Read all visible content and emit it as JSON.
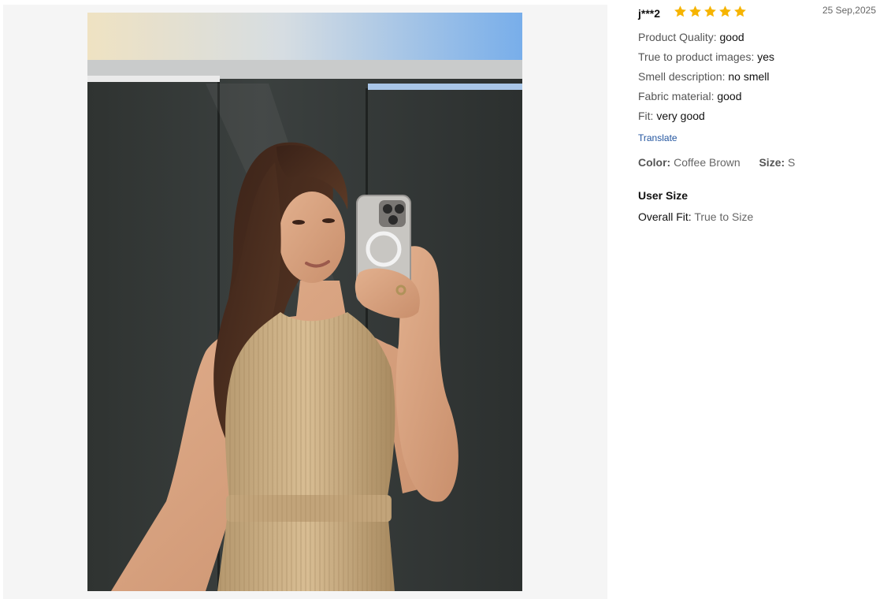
{
  "review": {
    "username": "j***2",
    "rating": 5,
    "date": "25 Sep,2025",
    "attributes": [
      {
        "label": "Product Quality:",
        "value": "good"
      },
      {
        "label": "True to product images:",
        "value": "yes"
      },
      {
        "label": "Smell description:",
        "value": "no smell"
      },
      {
        "label": "Fabric material:",
        "value": "good"
      },
      {
        "label": "Fit:",
        "value": "very good"
      }
    ],
    "translate_label": "Translate",
    "color_label": "Color:",
    "color_value": "Coffee Brown",
    "size_label": "Size:",
    "size_value": "S",
    "user_size_title": "User Size",
    "overall_fit_label": "Overall Fit:",
    "overall_fit_value": "True to Size"
  },
  "colors": {
    "star": "#f6b400",
    "link": "#2456a0",
    "viewer_bg": "#f5f5f5"
  },
  "icons": {
    "rating": "star-icon"
  }
}
